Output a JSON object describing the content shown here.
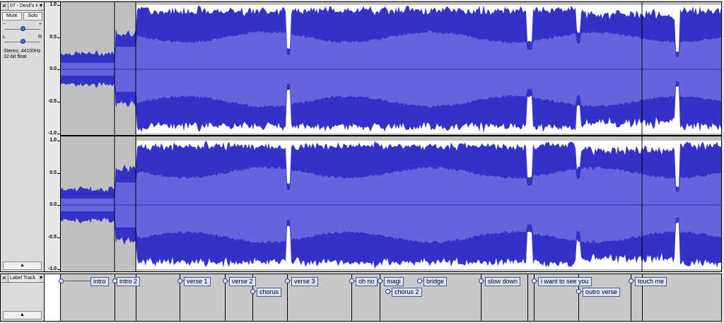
{
  "audio_track": {
    "name": "07 - Devil's H",
    "close_icon": "✕",
    "mute_label": "Mute",
    "solo_label": "Solo",
    "gain_minus": "−",
    "gain_plus": "+",
    "pan_left": "L",
    "pan_right": "R",
    "gain_level": 0.5,
    "pan_level": 0.5,
    "format_line1": "Stereo, 44100Hz",
    "format_line2": "32-bit float",
    "collapse_icon": "▲",
    "ruler_labels": [
      "1.0",
      "0.5",
      "0.0",
      "-0.5",
      "-1.0"
    ]
  },
  "label_track": {
    "name": "Label Track",
    "close_icon": "✕",
    "collapse_icon": "▲",
    "labels": [
      {
        "text": "intro",
        "row": 0
      },
      {
        "text": "intro 2",
        "row": 0
      },
      {
        "text": "verse 1",
        "row": 0
      },
      {
        "text": "verse 2",
        "row": 0
      },
      {
        "text": "chorus",
        "row": 1
      },
      {
        "text": "verse 3",
        "row": 0
      },
      {
        "text": "oh no",
        "row": 0
      },
      {
        "text": "magi",
        "row": 0
      },
      {
        "text": "chorus 2",
        "row": 1
      },
      {
        "text": "bridge",
        "row": 0
      },
      {
        "text": "slow down",
        "row": 0
      },
      {
        "text": "i want to see you",
        "row": 0
      },
      {
        "text": "outro verse",
        "row": 1
      },
      {
        "text": "touch me",
        "row": 0
      }
    ]
  },
  "colors": {
    "wave_peak": "#3232c8",
    "wave_rms": "#6464dc",
    "background": "#c0c0c0",
    "clip_bg": "#ffffff"
  },
  "icons": {
    "dropdown": "chevron-down-icon",
    "close": "close-icon",
    "collapse": "chevron-up-icon"
  }
}
